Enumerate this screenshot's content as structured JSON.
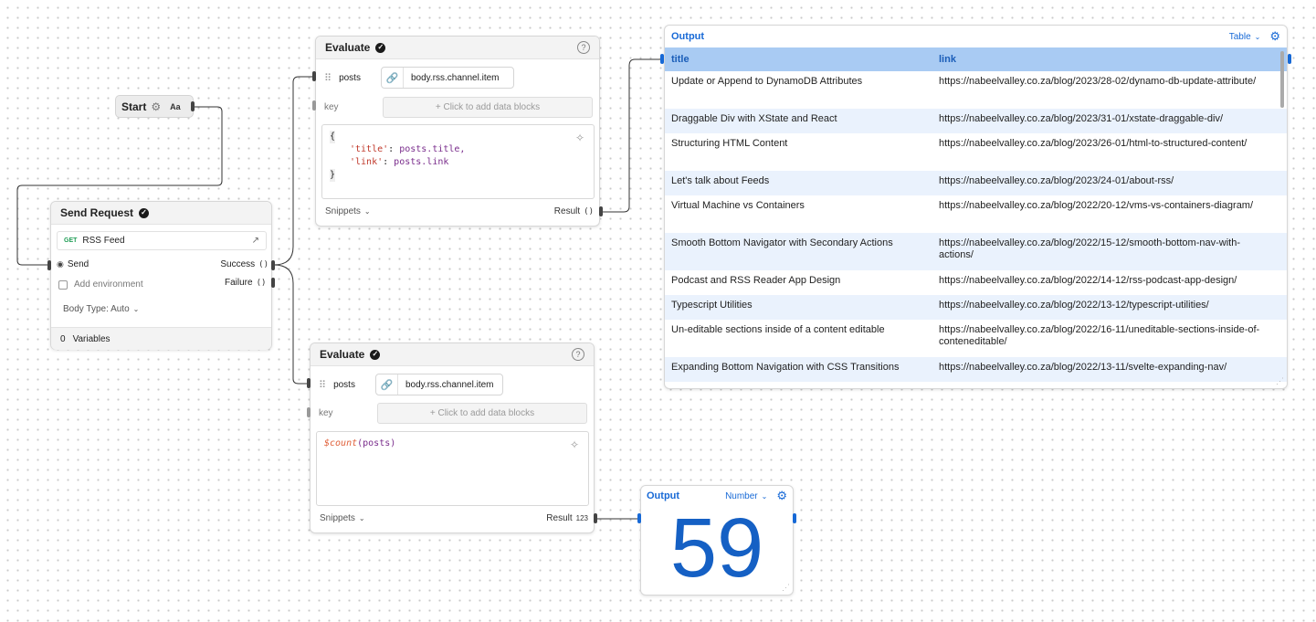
{
  "start": {
    "label": "Start",
    "gear_icon": "gear-icon",
    "format_label": "Aa"
  },
  "send_request": {
    "title": "Send Request",
    "method": "GET",
    "url_label": "RSS Feed",
    "send_label": "Send",
    "success_label": "Success",
    "failure_label": "Failure",
    "paren_symbol": "()",
    "environment_placeholder": "Add environment",
    "body_type": "Body Type: Auto",
    "variables_count": "0",
    "variables_label": "Variables"
  },
  "evaluate_top": {
    "title": "Evaluate",
    "help": "?",
    "var_name": "posts",
    "var_value": "body.rss.channel.item",
    "key_label": "key",
    "add_blocks": "+ Click to add data blocks",
    "code_line1": "{",
    "code_line2_key": "'title'",
    "code_line2_val": "posts.title,",
    "code_line3_key": "'link'",
    "code_line3_val": "posts.link",
    "code_line4": "}",
    "snippets": "Snippets",
    "result_label": "Result",
    "result_type": "()"
  },
  "evaluate_bottom": {
    "title": "Evaluate",
    "help": "?",
    "var_name": "posts",
    "var_value": "body.rss.channel.item",
    "key_label": "key",
    "add_blocks": "+ Click to add data blocks",
    "code_fn": "$count",
    "code_args": "(posts)",
    "snippets": "Snippets",
    "result_label": "Result",
    "result_type": "123"
  },
  "output_table": {
    "title": "Output",
    "view_select": "Table",
    "columns": [
      "title",
      "link"
    ],
    "rows": [
      {
        "title": "Update or Append to DynamoDB Attributes",
        "link": "https://nabeelvalley.co.za/blog/2023/28-02/dynamo-db-update-attribute/"
      },
      {
        "title": "Draggable Div with XState and React",
        "link": "https://nabeelvalley.co.za/blog/2023/31-01/xstate-draggable-div/"
      },
      {
        "title": "Structuring HTML Content",
        "link": "https://nabeelvalley.co.za/blog/2023/26-01/html-to-structured-content/"
      },
      {
        "title": "Let's talk about Feeds",
        "link": "https://nabeelvalley.co.za/blog/2023/24-01/about-rss/"
      },
      {
        "title": "Virtual Machine vs Containers",
        "link": "https://nabeelvalley.co.za/blog/2022/20-12/vms-vs-containers-diagram/"
      },
      {
        "title": "Smooth Bottom Navigator with Secondary Actions",
        "link": "https://nabeelvalley.co.za/blog/2022/15-12/smooth-bottom-nav-with-actions/"
      },
      {
        "title": "Podcast and RSS Reader App Design",
        "link": "https://nabeelvalley.co.za/blog/2022/14-12/rss-podcast-app-design/"
      },
      {
        "title": "Typescript Utilities",
        "link": "https://nabeelvalley.co.za/blog/2022/13-12/typescript-utilities/"
      },
      {
        "title": "Un-editable sections inside of a content editable",
        "link": "https://nabeelvalley.co.za/blog/2022/16-11/uneditable-sections-inside-of-conteneditable/"
      },
      {
        "title": "Expanding Bottom Navigation with CSS Transitions",
        "link": "https://nabeelvalley.co.za/blog/2022/13-11/svelte-expanding-nav/"
      }
    ]
  },
  "output_number": {
    "title": "Output",
    "view_select": "Number",
    "value": "59"
  },
  "colors": {
    "accent": "#1769d6",
    "header_row": "#a9cbf3",
    "alt_row": "#eaf2fd",
    "get_method": "#1f9d55",
    "code_key": "#c0392b",
    "code_val": "#7a2d8c"
  }
}
